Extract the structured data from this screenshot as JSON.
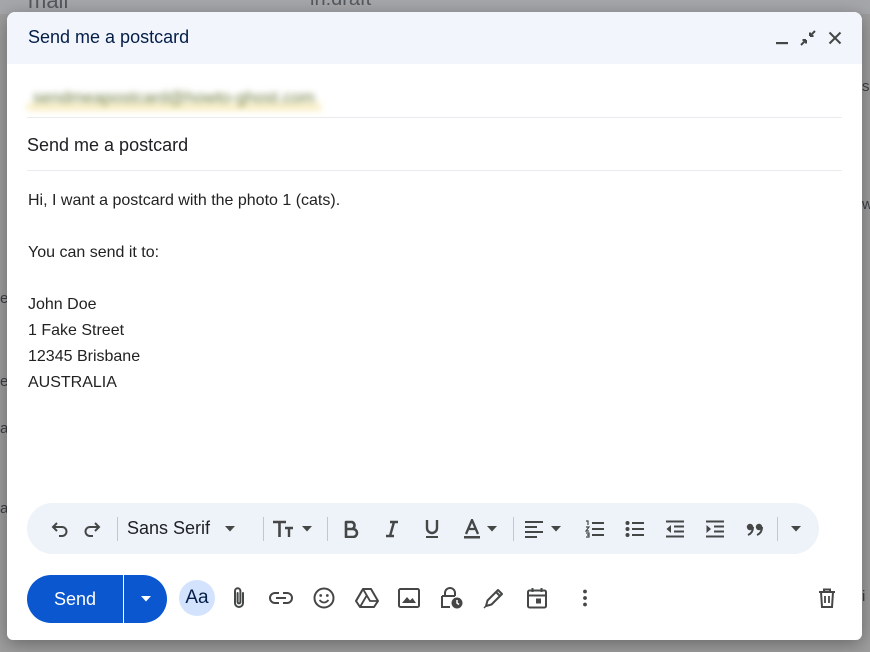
{
  "background": {
    "app_name_fragment": "mail",
    "search_fragment": "in:draft",
    "side_letters": [
      "e",
      "e",
      "a",
      "a"
    ],
    "right_letters": [
      "s",
      "w",
      "i"
    ]
  },
  "compose": {
    "title": "Send me a postcard",
    "recipient_blurred": "sendmeapostcard@howto-ghost.com",
    "subject": "Send me a postcard",
    "body_lines": [
      "Hi, I want a postcard with the photo 1 (cats).",
      "",
      "You can send it to:",
      "",
      "John Doe",
      "1 Fake Street",
      "12345 Brisbane",
      "AUSTRALIA"
    ]
  },
  "format_toolbar": {
    "font_family": "Sans Serif"
  },
  "bottom_bar": {
    "send_label": "Send",
    "text_format_label": "Aa"
  },
  "colors": {
    "accent": "#0b57d0",
    "header_bg": "#f2f6fc",
    "toolbar_bg": "#eef2f9"
  }
}
